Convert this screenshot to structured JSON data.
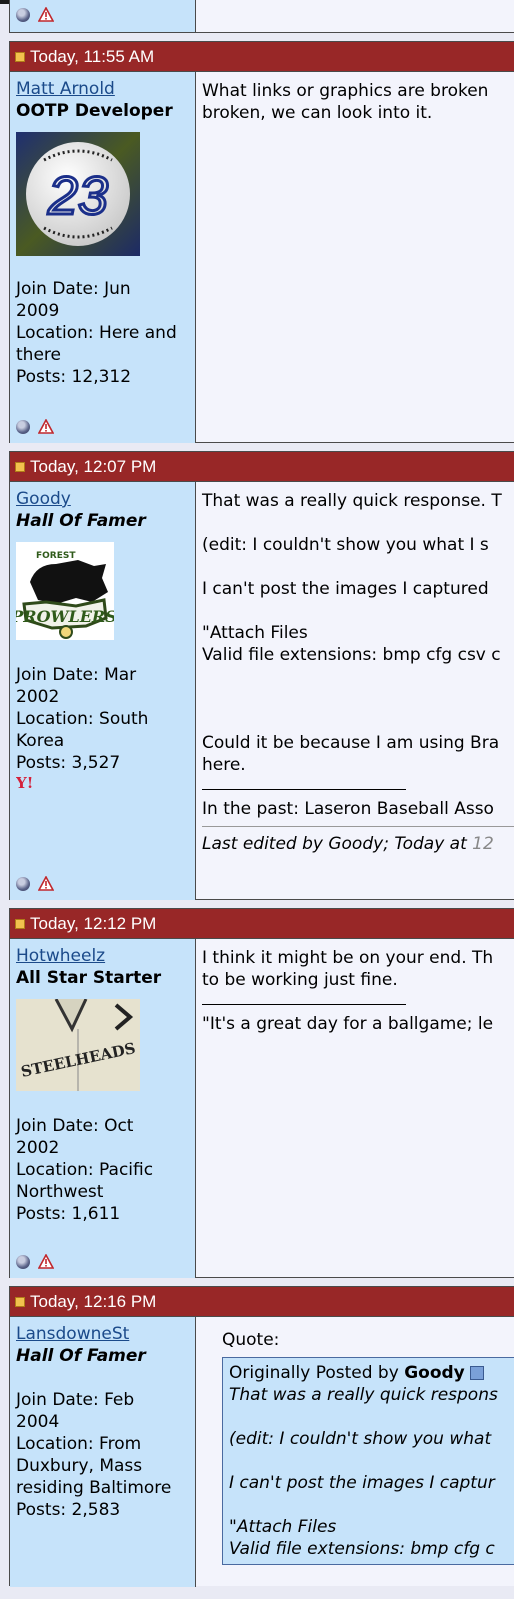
{
  "posts": [
    {
      "header": "",
      "username": "",
      "title": "",
      "fragment": true
    },
    {
      "header": "Today, 11:55 AM",
      "username": "Matt Arnold",
      "title": "OOTP Developer",
      "avatar_number": "23",
      "join": "Join Date: Jun",
      "join2": "2009",
      "loc": "Location: Here and",
      "loc2": "there",
      "posts": "Posts: 12,312",
      "lines": [
        "What links or graphics are broken",
        "broken, we can look into it."
      ]
    },
    {
      "header": "Today, 12:07 PM",
      "username": "Goody",
      "title": "Hall Of Famer",
      "avatar_text_top": "FOREST",
      "avatar_text_bottom": "PROWLERS",
      "join": "Join Date: Mar",
      "join2": "2002",
      "loc": "Location: South",
      "loc2": "Korea",
      "posts": "Posts: 3,527",
      "lines": [
        "That was a really quick response. T",
        "(edit: I couldn't show you what I s",
        "I can't post the images I captured",
        "\"Attach Files",
        "Valid file extensions: bmp cfg csv c",
        "Could it be because I am using Bra",
        "here.",
        "In the past: Laseron Baseball Asso"
      ],
      "edited_prefix": "Last edited by Goody; Today at ",
      "edited_time": "12"
    },
    {
      "header": "Today, 12:12 PM",
      "username": "Hotwheelz",
      "title": "All Star Starter",
      "avatar_text": "STEELHEADS",
      "join": "Join Date: Oct",
      "join2": "2002",
      "loc": "Location: Pacific",
      "loc2": "Northwest",
      "posts": "Posts: 1,611",
      "lines": [
        "I think it might be on your end. Th",
        "to be working just fine.",
        "\"It's a great day for a ballgame; le"
      ]
    },
    {
      "header": "Today, 12:16 PM",
      "username": "LansdowneSt",
      "title": "Hall Of Famer",
      "join": "Join Date: Feb",
      "join2": "2004",
      "loc": "Location: From",
      "loc2": "Duxbury, Mass",
      "loc3": "residing Baltimore",
      "posts": "Posts: 2,583",
      "quote_label": "Quote:",
      "quote_by_prefix": "Originally Posted by ",
      "quote_author": "Goody",
      "quote_lines": [
        "That was a really quick respons",
        "(edit: I couldn't show you what",
        "I can't post the images I captur",
        "\"Attach Files",
        "Valid file extensions: bmp cfg c"
      ]
    }
  ]
}
